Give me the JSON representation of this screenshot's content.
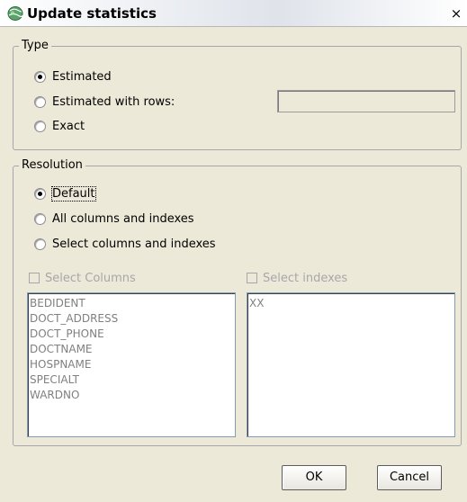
{
  "window": {
    "title": "Update statistics",
    "close_label": "×"
  },
  "type_group": {
    "legend": "Type",
    "options": [
      {
        "label": "Estimated",
        "checked": true
      },
      {
        "label": "Estimated with rows:",
        "checked": false
      },
      {
        "label": "Exact",
        "checked": false
      }
    ],
    "rows_value": ""
  },
  "resolution_group": {
    "legend": "Resolution",
    "options": [
      {
        "label": "Default",
        "checked": true
      },
      {
        "label": "All columns and indexes",
        "checked": false
      },
      {
        "label": "Select columns and indexes",
        "checked": false
      }
    ]
  },
  "columns": {
    "checkbox_label": "Select Columns",
    "items": [
      "BEDIDENT",
      "DOCT_ADDRESS",
      "DOCT_PHONE",
      "DOCTNAME",
      "HOSPNAME",
      "SPECIALT",
      "WARDNO"
    ]
  },
  "indexes": {
    "checkbox_label": "Select indexes",
    "items": [
      "XX"
    ]
  },
  "buttons": {
    "ok": "OK",
    "cancel": "Cancel"
  },
  "colors": {
    "dialog_bg": "#ece9d8",
    "disabled_text": "#a7a6aa",
    "list_border": "#7f9db9"
  },
  "icons": {
    "app": "globe-app-icon",
    "close": "close-icon"
  }
}
